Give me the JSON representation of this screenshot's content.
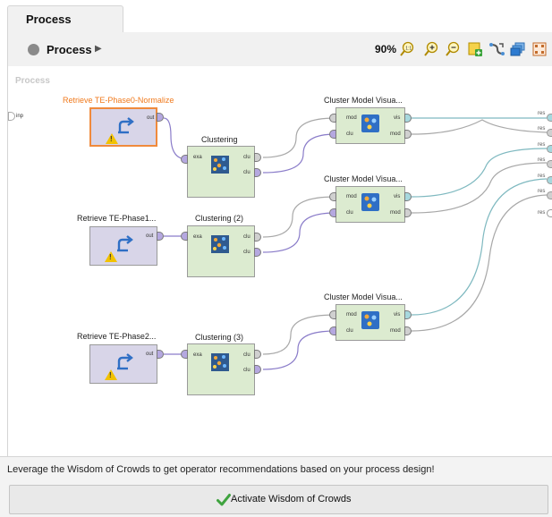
{
  "tabs": [
    {
      "label": "Process"
    }
  ],
  "toolbar": {
    "breadcrumb": "Process",
    "zoom": "90%",
    "icons": [
      "zoom-fit-icon",
      "zoom-in-icon",
      "zoom-out-icon",
      "add-note-icon",
      "auto-wire-icon",
      "layers-icon",
      "arrange-icon"
    ]
  },
  "canvas": {
    "label": "Process",
    "input_port": "inp",
    "result_ports": [
      "res",
      "res",
      "res",
      "res",
      "res",
      "res",
      "res"
    ]
  },
  "operators": {
    "retrieve0": {
      "title": "Retrieve TE-Phase0-Normalize",
      "port_out": "out"
    },
    "retrieve1": {
      "title": "Retrieve TE-Phase1...",
      "port_out": "out"
    },
    "retrieve2": {
      "title": "Retrieve TE-Phase2...",
      "port_out": "out"
    },
    "cluster0": {
      "title": "Clustering",
      "port_in": "exa",
      "port_out1": "clu",
      "port_out2": "clu"
    },
    "cluster1": {
      "title": "Clustering (2)",
      "port_in": "exa",
      "port_out1": "clu",
      "port_out2": "clu"
    },
    "cluster2": {
      "title": "Clustering (3)",
      "port_in": "exa",
      "port_out1": "clu",
      "port_out2": "clu"
    },
    "vis0": {
      "title": "Cluster Model Visua...",
      "port_in1": "mod",
      "port_in2": "clu",
      "port_out1": "vis",
      "port_out2": "mod"
    },
    "vis1": {
      "title": "Cluster Model Visua...",
      "port_in1": "mod",
      "port_in2": "clu",
      "port_out1": "vis",
      "port_out2": "mod"
    },
    "vis2": {
      "title": "Cluster Model Visua...",
      "port_in1": "mod",
      "port_in2": "clu",
      "port_out1": "vis",
      "port_out2": "mod"
    }
  },
  "recommendation": {
    "text": "Leverage the Wisdom of Crowds to get operator recommendations based on your process design!",
    "button_label": "Activate Wisdom of Crowds"
  },
  "colors": {
    "accent_orange": "#f07a1d",
    "retrieve_fill": "#d8d5e8",
    "cluster_fill": "#dcebd0",
    "wire_example": "#8a7cc9",
    "wire_model": "#9a9a9a",
    "wire_vis": "#7fb9c0",
    "check_green": "#3fa33f"
  }
}
